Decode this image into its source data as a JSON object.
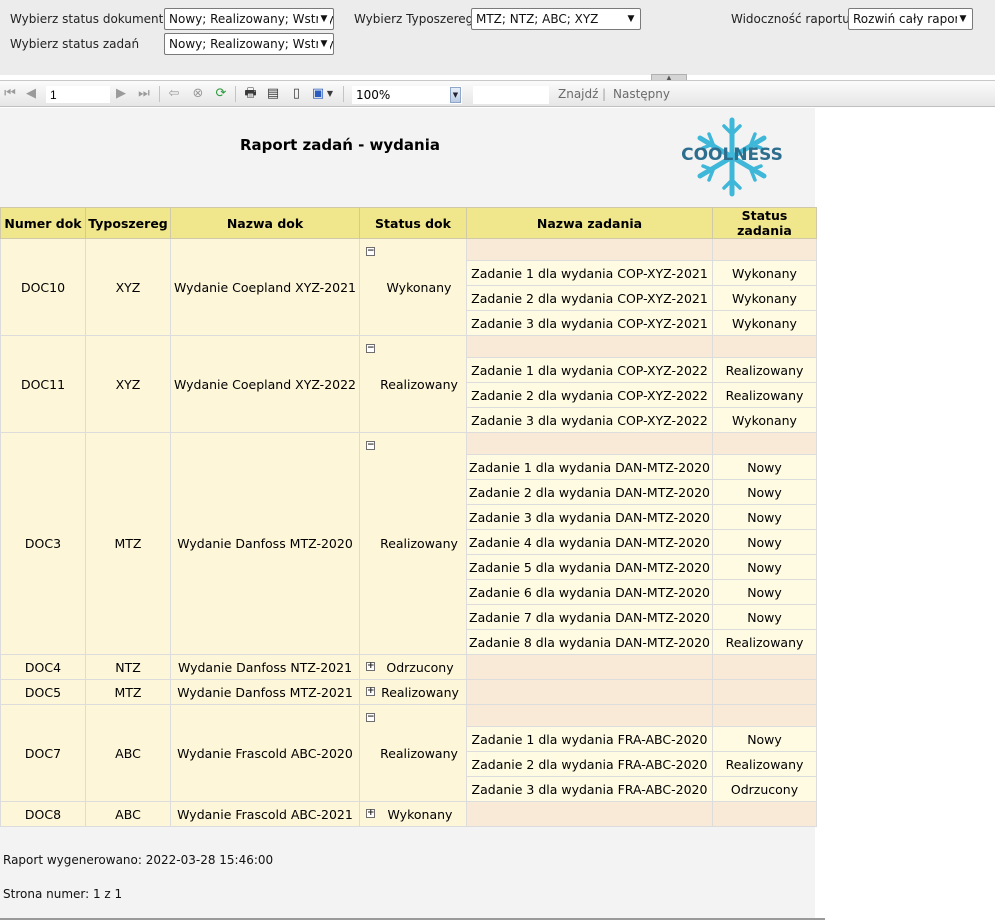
{
  "params": {
    "doc_status_label": "Wybierz status dokumentu",
    "doc_status_value": "Nowy; Realizowany; Wstrzymany",
    "task_status_label": "Wybierz status zadań",
    "task_status_value": "Nowy; Realizowany; Wstrzymany",
    "series_label": "Wybierz Typoszereg",
    "series_value": "MTZ; NTZ; ABC; XYZ",
    "visibility_label": "Widoczność raportu",
    "visibility_value": "Rozwiń cały raport"
  },
  "toolbar": {
    "page_value": "1",
    "zoom_value": "100%",
    "find_label": "Znajdź",
    "separator": "|",
    "next_label": "Następny"
  },
  "report": {
    "title": "Raport zadań - wydania",
    "logo_text": "COOLNESS",
    "columns": [
      "Numer dok",
      "Typoszereg",
      "Nazwa dok",
      "Status dok",
      "Nazwa zadania",
      "Status zadania"
    ],
    "generated_label": "Raport wygenerowano: 2022-03-28 15:46:00",
    "page_label": "Strona numer: 1 z 1",
    "docs": [
      {
        "num": "DOC10",
        "series": "XYZ",
        "name": "Wydanie Coepland XYZ-2021",
        "status": "Wykonany",
        "tasks": [
          {
            "name": "Zadanie 1 dla wydania COP-XYZ-2021",
            "status": "Wykonany"
          },
          {
            "name": "Zadanie 2 dla wydania COP-XYZ-2021",
            "status": "Wykonany"
          },
          {
            "name": "Zadanie 3 dla wydania COP-XYZ-2021",
            "status": "Wykonany"
          }
        ]
      },
      {
        "num": "DOC11",
        "series": "XYZ",
        "name": "Wydanie Coepland XYZ-2022",
        "status": "Realizowany",
        "tasks": [
          {
            "name": "Zadanie 1 dla wydania COP-XYZ-2022",
            "status": "Realizowany"
          },
          {
            "name": "Zadanie 2 dla wydania COP-XYZ-2022",
            "status": "Realizowany"
          },
          {
            "name": "Zadanie 3 dla wydania COP-XYZ-2022",
            "status": "Wykonany"
          }
        ]
      },
      {
        "num": "DOC3",
        "series": "MTZ",
        "name": "Wydanie Danfoss MTZ-2020",
        "status": "Realizowany",
        "tasks": [
          {
            "name": "Zadanie 1 dla wydania DAN-MTZ-2020",
            "status": "Nowy"
          },
          {
            "name": "Zadanie 2 dla wydania DAN-MTZ-2020",
            "status": "Nowy"
          },
          {
            "name": "Zadanie 3 dla wydania DAN-MTZ-2020",
            "status": "Nowy"
          },
          {
            "name": "Zadanie 4 dla wydania DAN-MTZ-2020",
            "status": "Nowy"
          },
          {
            "name": "Zadanie 5 dla wydania DAN-MTZ-2020",
            "status": "Nowy"
          },
          {
            "name": "Zadanie 6 dla wydania DAN-MTZ-2020",
            "status": "Nowy"
          },
          {
            "name": "Zadanie 7 dla wydania DAN-MTZ-2020",
            "status": "Nowy"
          },
          {
            "name": "Zadanie 8 dla wydania DAN-MTZ-2020",
            "status": "Realizowany"
          }
        ]
      },
      {
        "num": "DOC4",
        "series": "NTZ",
        "name": "Wydanie Danfoss NTZ-2021",
        "status": "Odrzucony",
        "tasks": []
      },
      {
        "num": "DOC5",
        "series": "MTZ",
        "name": "Wydanie Danfoss MTZ-2021",
        "status": "Realizowany",
        "tasks": []
      },
      {
        "num": "DOC7",
        "series": "ABC",
        "name": "Wydanie Frascold ABC-2020",
        "status": "Realizowany",
        "tasks": [
          {
            "name": "Zadanie 1 dla wydania FRA-ABC-2020",
            "status": "Nowy"
          },
          {
            "name": "Zadanie 2 dla wydania FRA-ABC-2020",
            "status": "Realizowany"
          },
          {
            "name": "Zadanie 3 dla wydania FRA-ABC-2020",
            "status": "Odrzucony"
          }
        ]
      },
      {
        "num": "DOC8",
        "series": "ABC",
        "name": "Wydanie Frascold ABC-2021",
        "status": "Wykonany",
        "tasks": []
      }
    ]
  }
}
